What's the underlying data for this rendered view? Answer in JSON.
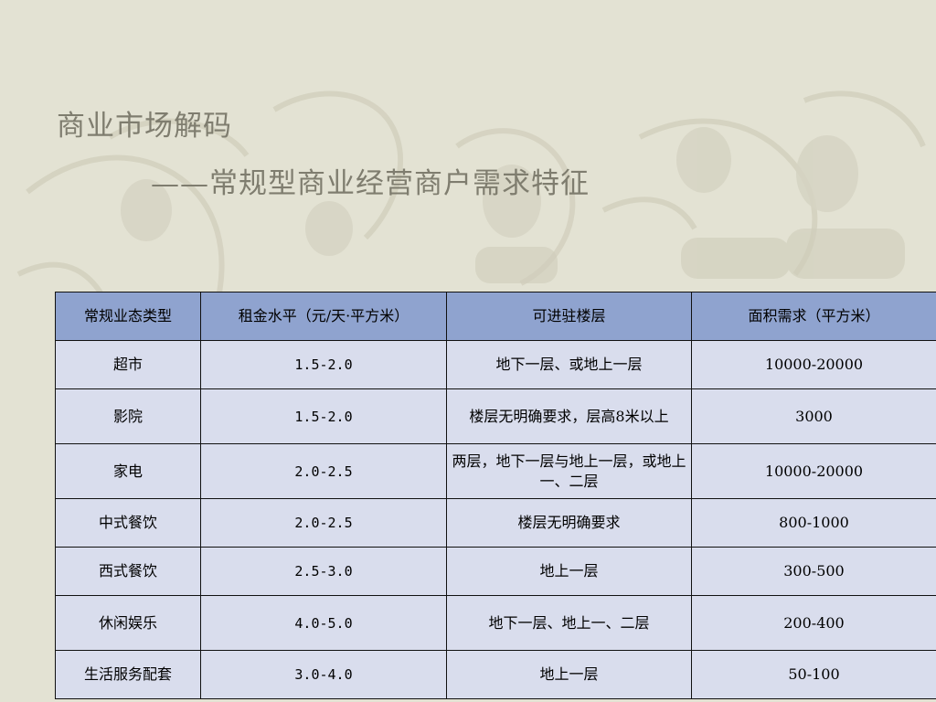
{
  "slide": {
    "title": "商业市场解码",
    "subtitle": "——常规型商业经营商户需求特征"
  },
  "table": {
    "headers": [
      "常规业态类型",
      "租金水平（元/天·平方米）",
      "可进驻楼层",
      "面积需求（平方米）"
    ],
    "rows": [
      [
        "超市",
        "1.5-2.0",
        "地下一层、或地上一层",
        "10000-20000"
      ],
      [
        "影院",
        "1.5-2.0",
        "楼层无明确要求，层高8米以上",
        "3000"
      ],
      [
        "家电",
        "2.0-2.5",
        "两层，地下一层与地上一层，或地上一、二层",
        "10000-20000"
      ],
      [
        "中式餐饮",
        "2.0-2.5",
        "楼层无明确要求",
        "800-1000"
      ],
      [
        "西式餐饮",
        "2.5-3.0",
        "地上一层",
        "300-500"
      ],
      [
        "休闲娱乐",
        "4.0-5.0",
        "地下一层、地上一、二层",
        "200-400"
      ],
      [
        "生活服务配套",
        "3.0-4.0",
        "地上一层",
        "50-100"
      ]
    ]
  },
  "colors": {
    "background": "#e3e2d3",
    "title_text": "#7f7d6f",
    "header_fill": "#8fa3cf",
    "cell_fill": "#d9dded"
  }
}
